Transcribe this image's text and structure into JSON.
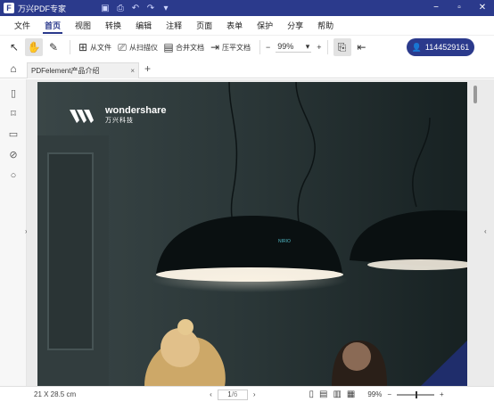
{
  "window": {
    "title": "万兴PDF专家",
    "logo_letter": "F",
    "quick_icons": [
      "save-icon",
      "print-icon",
      "undo-icon",
      "redo-icon",
      "customize-icon"
    ],
    "controls": [
      "−",
      "▫",
      "✕"
    ]
  },
  "menu": [
    "文件",
    "首页",
    "视图",
    "转换",
    "编辑",
    "注释",
    "页面",
    "表单",
    "保护",
    "分享",
    "帮助"
  ],
  "menu_active": "首页",
  "toolbar": {
    "from_file": "从文件",
    "from_scanner": "从扫描仪",
    "combine": "合并文档",
    "compress": "压平文档",
    "zoom_minus": "−",
    "zoom_value": "99%",
    "zoom_plus": "+",
    "user_id": "1144529161"
  },
  "tabs": {
    "document": "PDFelement产品介绍",
    "close": "×",
    "add": "+"
  },
  "sidebar_icons": [
    "page-thumbnails-icon",
    "bookmark-icon",
    "comment-icon",
    "attachment-icon",
    "search-icon"
  ],
  "document": {
    "brand": "wondershare",
    "brand_cn": "万兴科技",
    "lamp_text": "NIRIO"
  },
  "status": {
    "page_size": "21 X 28.5 cm",
    "page_current": "1",
    "page_total": "/6",
    "zoom": "99%",
    "zoom_level": 0.5
  },
  "colors": {
    "accent": "#2b3a8c",
    "page_bg": "#1f2d2e"
  }
}
